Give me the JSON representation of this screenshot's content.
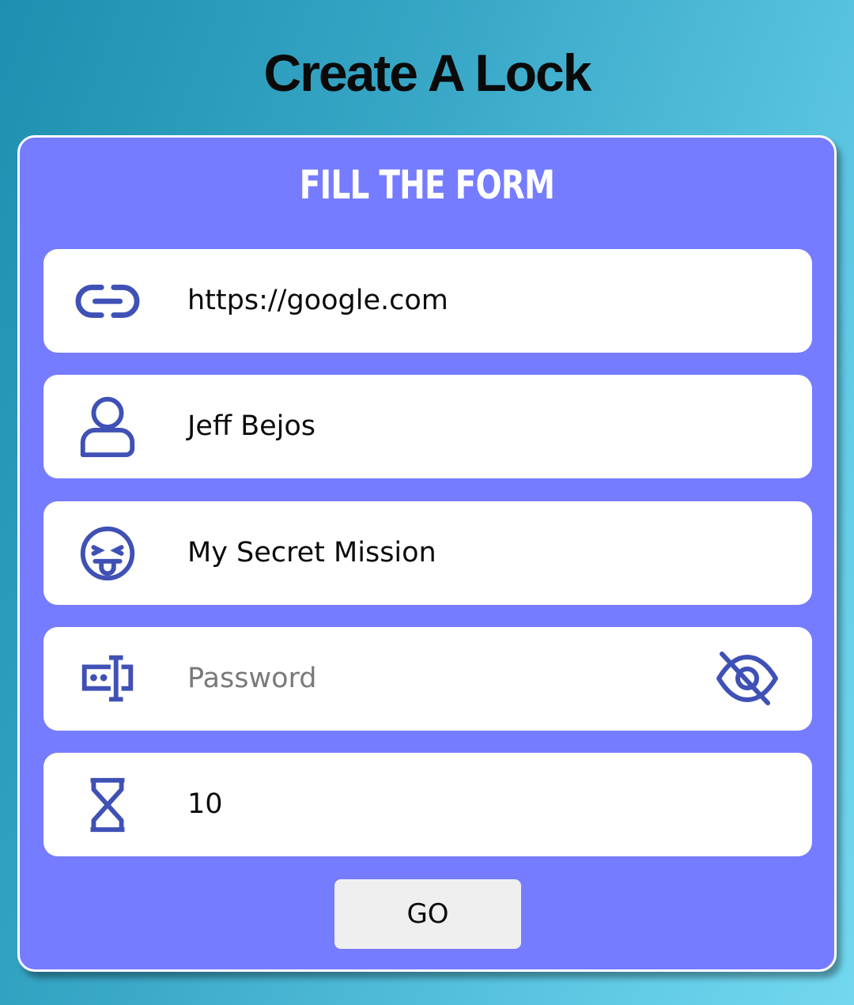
{
  "page": {
    "title": "Create A Lock"
  },
  "form": {
    "heading": "FILL THE FORM",
    "fields": [
      {
        "id": "url",
        "icon": "link-icon",
        "value": "https://google.com",
        "placeholder": ""
      },
      {
        "id": "name",
        "icon": "user-icon",
        "value": "Jeff Bejos",
        "placeholder": ""
      },
      {
        "id": "title",
        "icon": "tongue-emoji-icon",
        "value": "My Secret Mission",
        "placeholder": ""
      },
      {
        "id": "password",
        "icon": "password-field-icon",
        "value": "",
        "placeholder": "Password",
        "toggle_icon": "eye-off-icon"
      },
      {
        "id": "duration",
        "icon": "hourglass-icon",
        "value": "10",
        "placeholder": ""
      }
    ],
    "submit_label": "GO"
  },
  "colors": {
    "background_start": "#1e8fb0",
    "background_end": "#72d8ef",
    "card": "#767cff",
    "icon": "#3f51b5",
    "button": "#efeff0"
  }
}
